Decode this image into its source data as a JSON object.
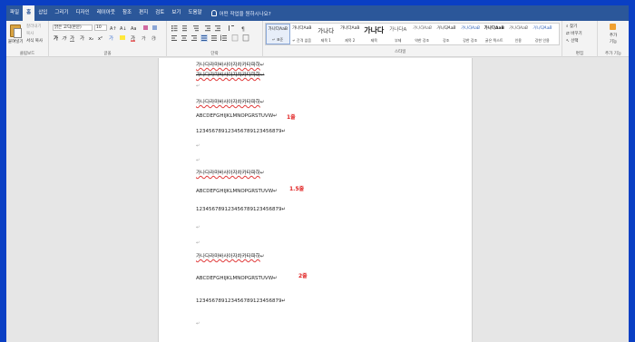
{
  "tabs": [
    "파일",
    "홈",
    "삽입",
    "그리기",
    "디자인",
    "레이아웃",
    "참조",
    "편지",
    "검토",
    "보기",
    "도움말"
  ],
  "active_tab": "홈",
  "tell_me": "어떤 작업을 원하시나요?",
  "clipboard": {
    "paste": "붙여넣기",
    "cut": "잘라내기",
    "copy": "복사",
    "format_painter": "서식 복사",
    "label": "클립보드"
  },
  "font": {
    "name": "맑은 고딕(본문)",
    "size": "10",
    "label": "글꼴"
  },
  "paragraph": {
    "label": "단락"
  },
  "styles": {
    "label": "스타일",
    "items": [
      {
        "preview": "가나다AaB",
        "name": "↵ 표준"
      },
      {
        "preview": "가나다AaB",
        "name": "↵ 간격 없음"
      },
      {
        "preview": "가나다",
        "name": "제목 1"
      },
      {
        "preview": "가나다AaB",
        "name": "제목 2"
      },
      {
        "preview": "가나다",
        "name": "제목"
      },
      {
        "preview": "가나다A",
        "name": "부제"
      },
      {
        "preview": "가나다AaB",
        "name": "약한 강조"
      },
      {
        "preview": "가나다AaB",
        "name": "강조"
      },
      {
        "preview": "가나다AaB",
        "name": "강한 강조"
      },
      {
        "preview": "가나다AaB",
        "name": "굵은 텍스트"
      },
      {
        "preview": "가나다AaB",
        "name": "인용"
      },
      {
        "preview": "가나다AaB",
        "name": "강한 인용"
      }
    ]
  },
  "editing": {
    "find": "찾기",
    "replace": "바꾸기",
    "select": "선택",
    "label": "편집"
  },
  "addins": {
    "label1": "추가",
    "label2": "기능",
    "label": "추가 기능"
  },
  "document": {
    "top_line": "가나다라마바사아자차카타파하",
    "strike_line": "가나다라마바사아자차카타파하",
    "ko_line": "가나다라마바사아자차카타파하",
    "en_line": "ABCDEFGHIJKLMNOPGRSTUVW",
    "num_line": "123456789123456789123456879",
    "num_line_2": "123456789123456789123456879",
    "num_line_3": "123456789123456789123456879",
    "mark": "↵",
    "note_1": "1줄",
    "note_15": "1.5줄",
    "note_2": "2줄"
  }
}
